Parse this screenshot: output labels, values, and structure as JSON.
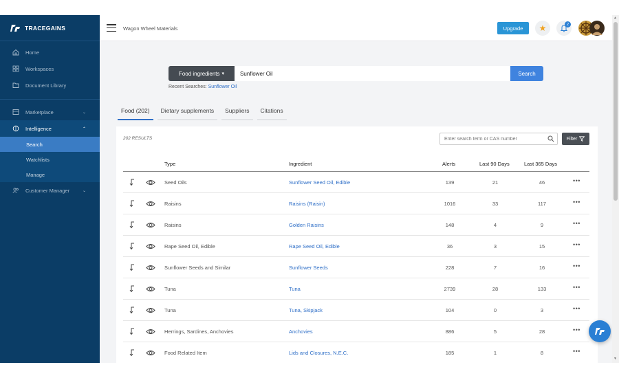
{
  "brand": {
    "name": "TRACEGAINS"
  },
  "sidebar": {
    "items": [
      {
        "label": "Home",
        "icon": "home-icon"
      },
      {
        "label": "Workspaces",
        "icon": "grid-icon"
      },
      {
        "label": "Document Library",
        "icon": "folder-icon"
      },
      {
        "label": "Marketplace",
        "icon": "store-icon"
      },
      {
        "label": "Intelligence",
        "icon": "brain-icon"
      },
      {
        "label": "Customer Manager",
        "icon": "users-icon"
      }
    ],
    "intelligence_sub": [
      {
        "label": "Search"
      },
      {
        "label": "Watchlists"
      },
      {
        "label": "Manage"
      }
    ]
  },
  "header": {
    "company": "Wagon Wheel Materials",
    "upgrade_label": "Upgrade",
    "notifications_count": "2"
  },
  "search": {
    "category": "Food ingredients",
    "value": "Sunflower Oil",
    "button": "Search",
    "recent_label": "Recent Searches:",
    "recent_value": "Sunflower Oil"
  },
  "tabs": [
    {
      "label": "Food (202)"
    },
    {
      "label": "Dietary supplements"
    },
    {
      "label": "Suppliers"
    },
    {
      "label": "Citations"
    }
  ],
  "results": {
    "count_label": "202 RESULTS",
    "filter_placeholder": "Enter search term or CAS number",
    "filter_button": "Filter",
    "columns": {
      "type": "Type",
      "ingredient": "Ingredient",
      "alerts": "Alerts",
      "last90": "Last 90 Days",
      "last365": "Last 365 Days"
    },
    "rows": [
      {
        "type": "Seed Oils",
        "ingredient": "Sunflower Seed Oil, Edible",
        "alerts": "139",
        "last90": "21",
        "last365": "46"
      },
      {
        "type": "Raisins",
        "ingredient": "Raisins (Raisin)",
        "alerts": "1016",
        "last90": "33",
        "last365": "117"
      },
      {
        "type": "Raisins",
        "ingredient": "Golden Raisins",
        "alerts": "148",
        "last90": "4",
        "last365": "9"
      },
      {
        "type": "Rape Seed Oil, Edible",
        "ingredient": "Rape Seed Oil, Edible",
        "alerts": "36",
        "last90": "3",
        "last365": "15"
      },
      {
        "type": "Sunflower Seeds and Similar",
        "ingredient": "Sunflower Seeds",
        "alerts": "228",
        "last90": "7",
        "last365": "16"
      },
      {
        "type": "Tuna",
        "ingredient": "Tuna",
        "alerts": "2739",
        "last90": "28",
        "last365": "133"
      },
      {
        "type": "Tuna",
        "ingredient": "Tuna, Skipjack",
        "alerts": "104",
        "last90": "0",
        "last365": "3"
      },
      {
        "type": "Herrings, Sardines, Anchovies",
        "ingredient": "Anchovies",
        "alerts": "886",
        "last90": "5",
        "last365": "28"
      },
      {
        "type": "Food Related Item",
        "ingredient": "Lids and Closures, N.E.C.",
        "alerts": "185",
        "last90": "1",
        "last365": "8"
      }
    ]
  },
  "colors": {
    "sidebar": "#0b3d66",
    "accent": "#3f83df",
    "link": "#2f6fc7",
    "upgrade": "#2a95d6"
  }
}
